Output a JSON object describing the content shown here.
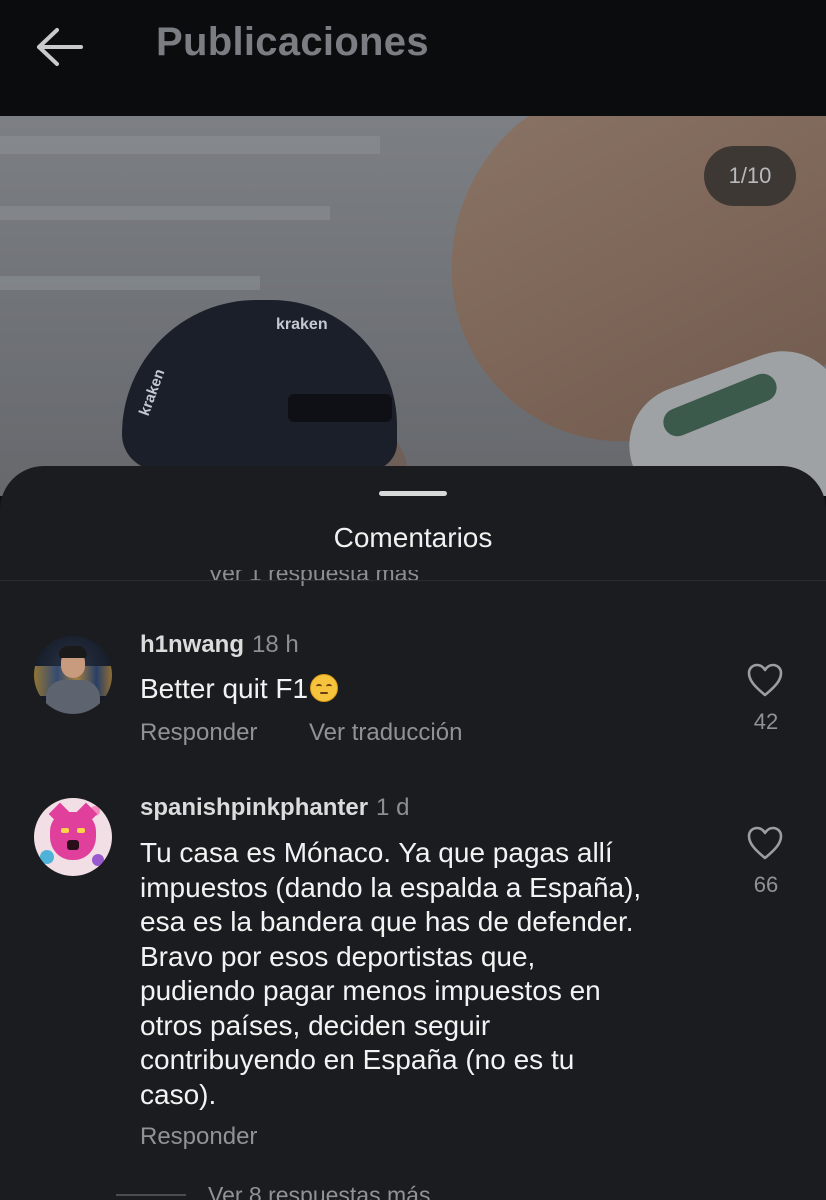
{
  "topbar": {
    "title": "Publicaciones"
  },
  "photo": {
    "counter": "1/10",
    "cap_brand": "kraken",
    "cap_side_text": "kraken"
  },
  "sheet": {
    "title": "Comentarios",
    "previous_replies": "Ver 1 respuesta más"
  },
  "comments": [
    {
      "username": "h1nwang",
      "time": "18 h",
      "text": "Better quit F1",
      "emoji": "face-with-worried-eyes",
      "reply_label": "Responder",
      "translate_label": "Ver traducción",
      "likes": "42"
    },
    {
      "username": "spanishpinkphanter",
      "time": "1 d",
      "lines": [
        "Tu casa es Mónaco. Ya que pagas allí",
        "impuestos (dando la espalda a España),",
        "esa es la bandera que has de defender.",
        "Bravo por esos deportistas que,",
        "pudiendo pagar menos impuestos en",
        "otros países, deciden seguir",
        "contribuyendo en España (no es tu",
        "caso)."
      ],
      "reply_label": "Responder",
      "likes": "66",
      "more_replies": "Ver 8 respuestas más"
    }
  ],
  "colors": {
    "sheet_bg": "#1b1c1f",
    "topbar_bg": "#0b0c0d",
    "muted_text": "#8f9297"
  }
}
